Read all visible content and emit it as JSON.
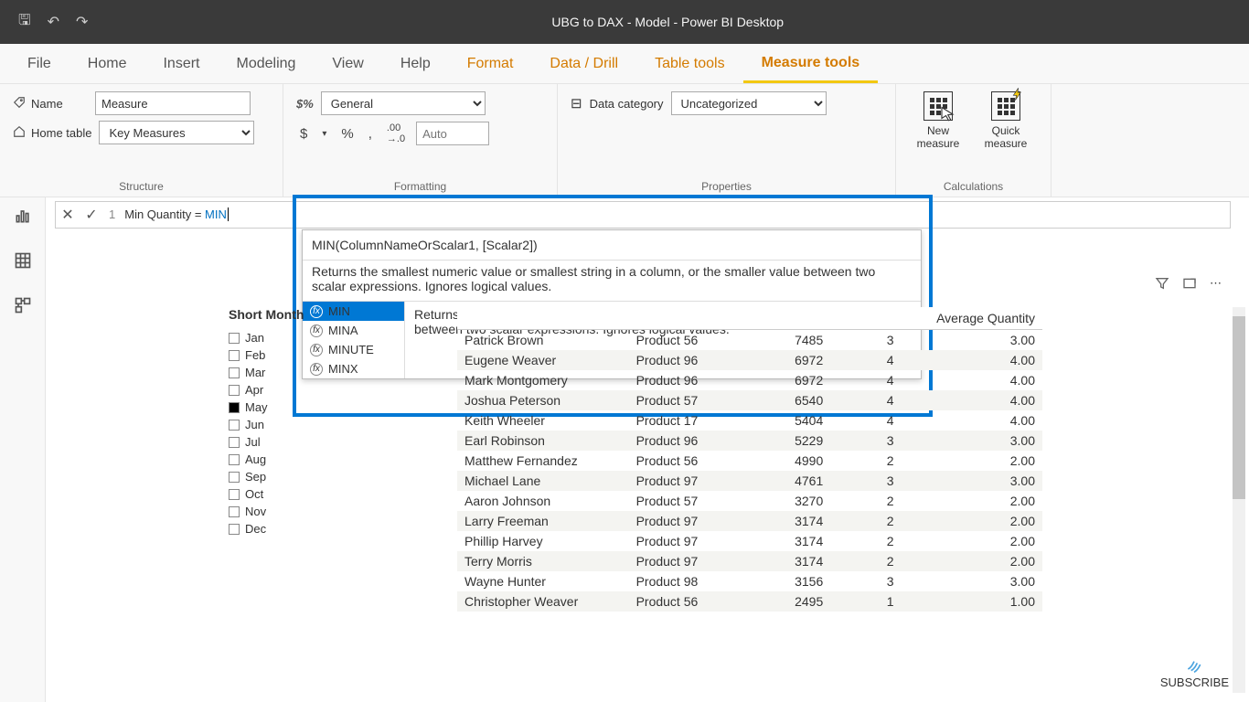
{
  "app": {
    "title": "UBG to DAX - Model - Power BI Desktop"
  },
  "menu": {
    "file": "File",
    "home": "Home",
    "insert": "Insert",
    "modeling": "Modeling",
    "view": "View",
    "help": "Help",
    "format": "Format",
    "datadrill": "Data / Drill",
    "tabletools": "Table tools",
    "measuretools": "Measure tools"
  },
  "ribbon": {
    "name_lbl": "Name",
    "name_val": "Measure",
    "home_lbl": "Home table",
    "home_val": "Key Measures",
    "structure": "Structure",
    "format_val": "General",
    "currency": "$",
    "percent": "%",
    "comma": ",",
    "dec": "⁰⁰",
    "auto": "Auto",
    "formatting": "Formatting",
    "spct": "$%",
    "datacat_lbl": "Data category",
    "datacat_val": "Uncategorized",
    "properties": "Properties",
    "newmeasure": "New measure",
    "quickmeasure": "Quick measure",
    "calculations": "Calculations"
  },
  "formula": {
    "line": "1",
    "pre": "Min Quantity = ",
    "fn": "MIN"
  },
  "intelli": {
    "sig": "MIN(ColumnNameOrScalar1, [Scalar2])",
    "desc": "Returns the smallest numeric value or smallest string in a column, or the smaller value between two scalar expressions. Ignores logical values.",
    "items": [
      "MIN",
      "MINA",
      "MINUTE",
      "MINX"
    ],
    "itemdesc": "Returns the smallest numeric value or smallest string in a column, or the smaller value between two scalar expressions. Ignores logical values."
  },
  "slicer": {
    "title": "Short Month",
    "items": [
      {
        "label": "Jan",
        "on": false
      },
      {
        "label": "Feb",
        "on": false
      },
      {
        "label": "Mar",
        "on": false
      },
      {
        "label": "Apr",
        "on": false
      },
      {
        "label": "May",
        "on": true
      },
      {
        "label": "Jun",
        "on": false
      },
      {
        "label": "Jul",
        "on": false
      },
      {
        "label": "Aug",
        "on": false
      },
      {
        "label": "Sep",
        "on": false
      },
      {
        "label": "Oct",
        "on": false
      },
      {
        "label": "Nov",
        "on": false
      },
      {
        "label": "Dec",
        "on": false
      }
    ]
  },
  "table": {
    "headers": {
      "avgqty": "Average Quantity"
    },
    "rows": [
      {
        "name": "Patrick Brown",
        "prod": "Product 56",
        "v": "7485",
        "q": "3",
        "avg": "3.00"
      },
      {
        "name": "Eugene Weaver",
        "prod": "Product 96",
        "v": "6972",
        "q": "4",
        "avg": "4.00"
      },
      {
        "name": "Mark Montgomery",
        "prod": "Product 96",
        "v": "6972",
        "q": "4",
        "avg": "4.00"
      },
      {
        "name": "Joshua Peterson",
        "prod": "Product 57",
        "v": "6540",
        "q": "4",
        "avg": "4.00"
      },
      {
        "name": "Keith Wheeler",
        "prod": "Product 17",
        "v": "5404",
        "q": "4",
        "avg": "4.00"
      },
      {
        "name": "Earl Robinson",
        "prod": "Product 96",
        "v": "5229",
        "q": "3",
        "avg": "3.00"
      },
      {
        "name": "Matthew Fernandez",
        "prod": "Product 56",
        "v": "4990",
        "q": "2",
        "avg": "2.00"
      },
      {
        "name": "Michael Lane",
        "prod": "Product 97",
        "v": "4761",
        "q": "3",
        "avg": "3.00"
      },
      {
        "name": "Aaron Johnson",
        "prod": "Product 57",
        "v": "3270",
        "q": "2",
        "avg": "2.00"
      },
      {
        "name": "Larry Freeman",
        "prod": "Product 97",
        "v": "3174",
        "q": "2",
        "avg": "2.00"
      },
      {
        "name": "Phillip Harvey",
        "prod": "Product 97",
        "v": "3174",
        "q": "2",
        "avg": "2.00"
      },
      {
        "name": "Terry Morris",
        "prod": "Product 97",
        "v": "3174",
        "q": "2",
        "avg": "2.00"
      },
      {
        "name": "Wayne Hunter",
        "prod": "Product 98",
        "v": "3156",
        "q": "3",
        "avg": "3.00"
      },
      {
        "name": "Christopher Weaver",
        "prod": "Product 56",
        "v": "2495",
        "q": "1",
        "avg": "1.00"
      }
    ]
  },
  "subscribe": "SUBSCRIBE"
}
